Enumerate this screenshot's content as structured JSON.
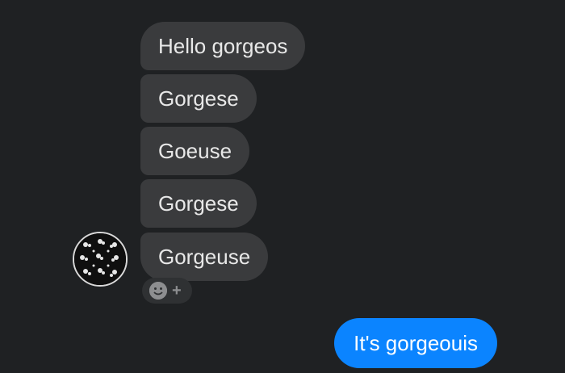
{
  "conversation": {
    "received": [
      "Hello gorgeos",
      "Gorgese",
      "Goeuse",
      "Gorgese",
      "Gorgeuse"
    ],
    "sent": [
      "It's gorgeouis"
    ],
    "reaction_add_symbol": "+"
  },
  "colors": {
    "background": "#1f2123",
    "received_bubble": "#3a3b3d",
    "sent_bubble": "#0b84ff"
  },
  "icons": {
    "reaction": "smiley-icon",
    "add": "plus-icon",
    "sender": "avatar"
  }
}
